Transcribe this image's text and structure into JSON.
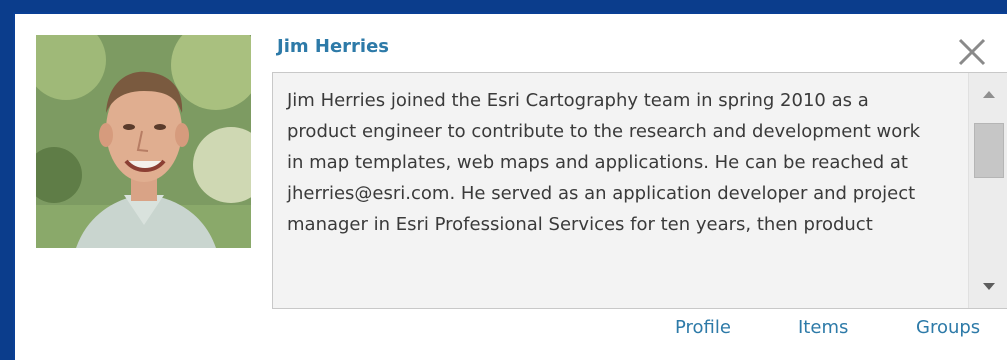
{
  "profile_popup": {
    "name": "Jim Herries",
    "bio": "Jim Herries joined the Esri Cartography team in spring 2010 as a product engineer to contribute to the research and development work in map templates, web maps and applications.  He can be reached at jherries@esri.com.  He served as an application developer and project manager in Esri Professional Services for ten years, then product",
    "links": {
      "profile": "Profile",
      "items": "Items",
      "groups": "Groups"
    }
  },
  "icons": {
    "close": "close-icon",
    "scroll_up": "scroll-up-arrow-icon",
    "scroll_down": "scroll-down-arrow-icon"
  },
  "colors": {
    "frame_blue": "#0b3d8c",
    "link_blue": "#2d7aa8",
    "bio_background": "#f3f3f3",
    "scrollbar_thumb": "#c6c6c6"
  }
}
